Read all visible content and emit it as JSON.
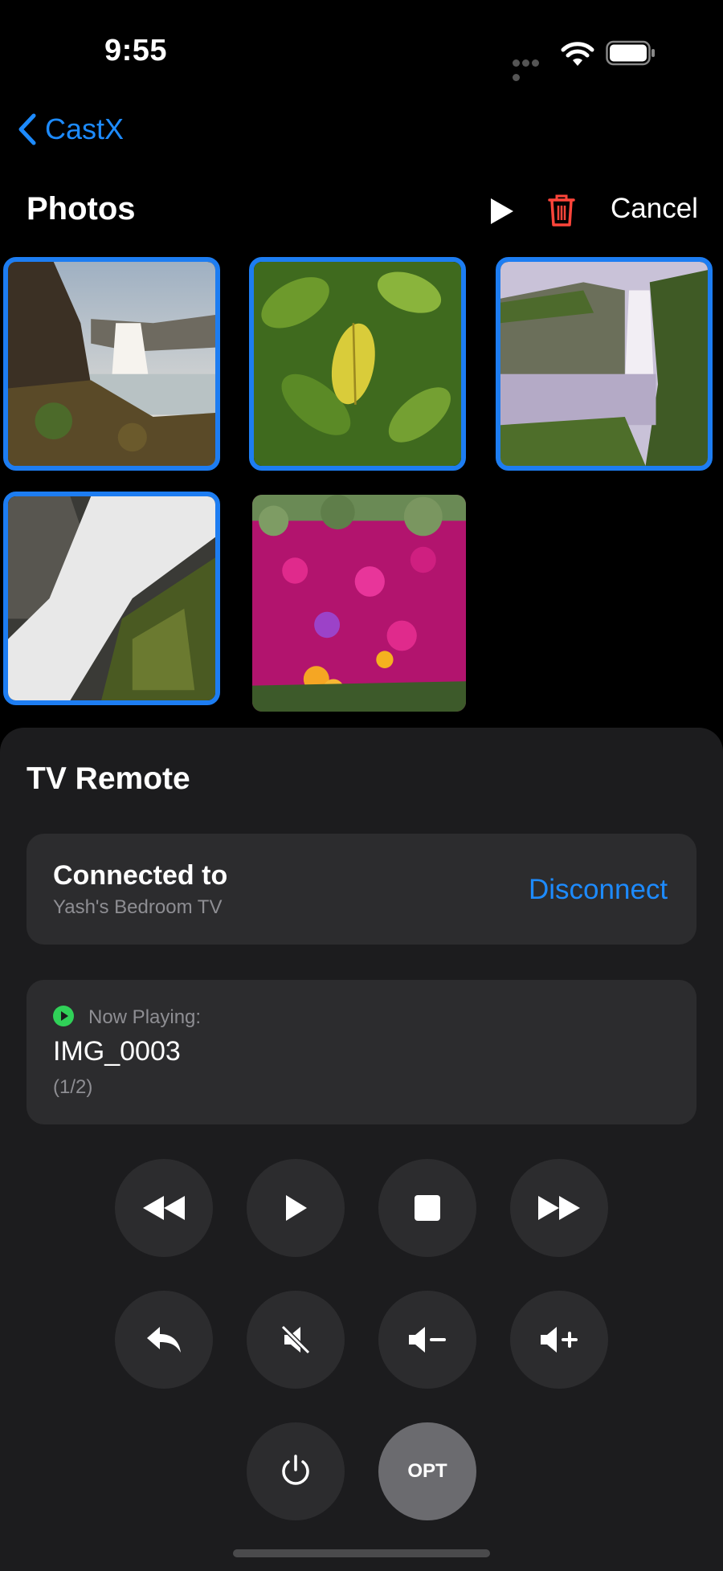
{
  "status_bar": {
    "time": "9:55"
  },
  "nav": {
    "back_label": "CastX"
  },
  "header": {
    "title": "Photos",
    "cancel_label": "Cancel"
  },
  "photos": [
    {
      "name": "waterfall-cliff",
      "selected": true
    },
    {
      "name": "green-leaves",
      "selected": true
    },
    {
      "name": "waterfall-valley",
      "selected": true
    },
    {
      "name": "waterfall-closeup",
      "selected": true
    },
    {
      "name": "pink-flowers",
      "selected": false
    }
  ],
  "remote": {
    "title": "TV Remote",
    "connected_label": "Connected to",
    "device_name": "Yash's Bedroom TV",
    "disconnect_label": "Disconnect",
    "now_playing_label": "Now Playing:",
    "now_playing_title": "IMG_0003",
    "now_playing_count": "(1/2)",
    "opt_label": "OPT"
  },
  "colors": {
    "accent": "#1d8bff",
    "selection": "#1d7df2",
    "danger": "#ff453a",
    "playing": "#30d158"
  }
}
